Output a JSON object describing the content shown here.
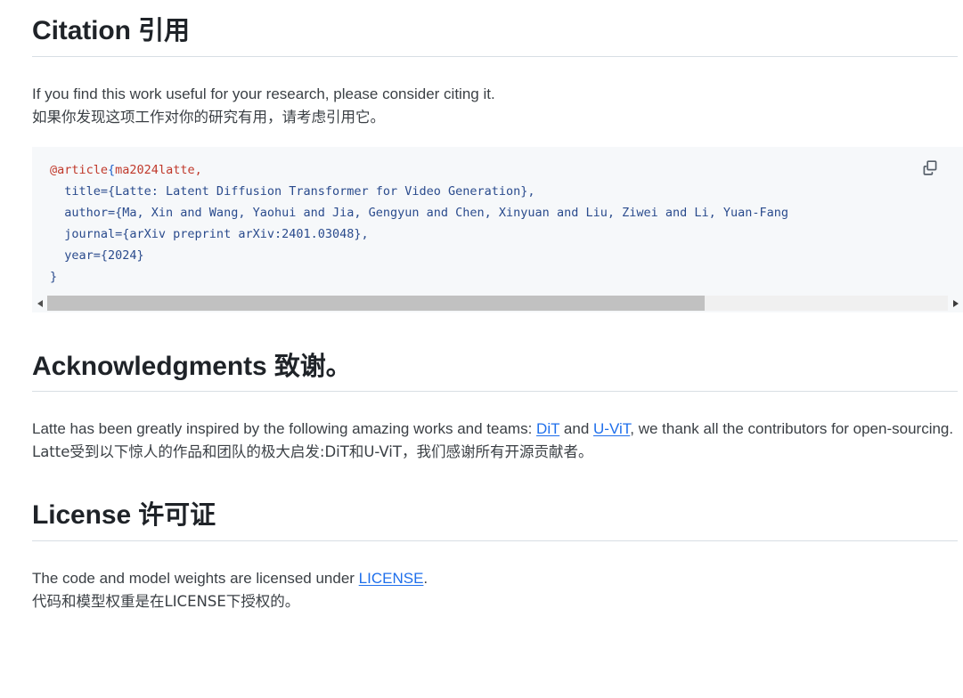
{
  "sections": {
    "citation": {
      "heading_en": "Citation",
      "heading_cjk": "引用",
      "paragraph_en": "If you find this work useful for your research, please consider citing it.",
      "paragraph_cjk": "如果你发现这项工作对你的研究有用，请考虑引用它。",
      "code": {
        "language": "bibtex",
        "entry_type": "@article",
        "open_brace": "{",
        "cite_key": "ma2024latte,",
        "line_title": "  title={Latte: Latent Diffusion Transformer for Video Generation},",
        "line_author": "  author={Ma, Xin and Wang, Yaohui and Jia, Gengyun and Chen, Xinyuan and Liu, Ziwei and Li, Yuan-Fang",
        "line_journal": "  journal={arXiv preprint arXiv:2401.03048},",
        "line_year": "  year={2024}",
        "line_close": "}",
        "copy_icon": "copy-icon",
        "copy_label": "Copy"
      },
      "scrollbar": {
        "left_arrow_icon": "chevron-left-icon",
        "right_arrow_icon": "chevron-right-icon",
        "thumb_fraction_percent": 73
      }
    },
    "acknowledgments": {
      "heading_en": "Acknowledgments",
      "heading_cjk": "致谢。",
      "paragraph_en_part1": "Latte has been greatly inspired by the following amazing works and teams: ",
      "link_dit": "DiT",
      "paragraph_en_part2": " and ",
      "link_uvit": "U-ViT",
      "paragraph_en_part3": ", we thank all the contributors for open-sourcing.",
      "paragraph_cjk": "Latte受到以下惊人的作品和团队的极大启发:DiT和U-ViT，我们感谢所有开源贡献者。"
    },
    "license": {
      "heading_en": "License",
      "heading_cjk": "许可证",
      "paragraph_en_part1": "The code and model weights are licensed under ",
      "link_license": "LICENSE",
      "paragraph_en_part2": ".",
      "paragraph_cjk": "代码和模型权重是在LICENSE下授权的。"
    }
  },
  "colors": {
    "page_background": "#ffffff",
    "code_background": "#f6f8fa",
    "heading_text": "#1f2328",
    "body_text": "#3b4045",
    "link": "#1f6feb",
    "code_text": "#2a4b8d",
    "code_keyword": "#c0392b",
    "divider": "#d8dee4",
    "scrollbar_thumb": "#c1c1c1",
    "scrollbar_track": "#f0f0f0"
  }
}
